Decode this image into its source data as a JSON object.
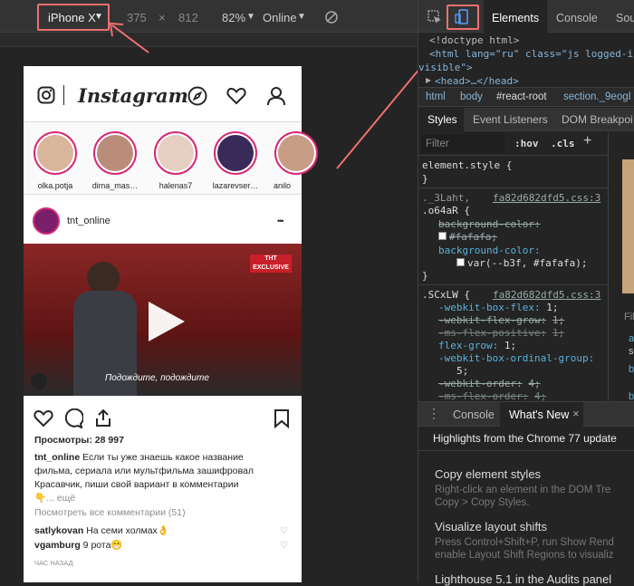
{
  "toolbar": {
    "device": "iPhone X",
    "width": "375",
    "times": "×",
    "height": "812",
    "zoom": "82%",
    "network": "Online"
  },
  "devtools": {
    "tabs": [
      "Elements",
      "Console",
      "Sou"
    ],
    "dom": {
      "line1": "<!doctype html>",
      "line2": "<html lang=\"ru\" class=\"js logged-i",
      "line3": "visible\">",
      "line4": "<head>…</head>"
    },
    "breadcrumb": [
      "html",
      "body",
      "#react-root",
      "section._9eogI"
    ],
    "style_tabs": [
      "Styles",
      "Event Listeners",
      "DOM Breakpoi"
    ],
    "filter_placeholder": "Filter",
    "hov": ":hov",
    "cls": ".cls",
    "plus": "+",
    "rules": {
      "r0_selector": "element.style {",
      "r0_close": "}",
      "r1_selector": "._3Laht,",
      "r1_selector2": ".o64aR {",
      "r1_link": "fa82d682dfd5.css:3",
      "r1_p1": "background-color:",
      "r1_v1": "#fafafa;",
      "r1_p2": "background-color:",
      "r1_v2": "var(--b3f, #fafafa);",
      "r1_close": "}",
      "r2_selector": ".SCxLW {",
      "r2_link": "fa82d682dfd5.css:3",
      "r2_p1": "-webkit-box-flex:",
      "r2_v1": "1;",
      "r2_p2": "-webkit-flex-grow:",
      "r2_v2": "1;",
      "r2_p3": "-ms-flex-positive:",
      "r2_v3": "1;",
      "r2_p4": "flex-grow:",
      "r2_v4": "1;",
      "r2_p5": "-webkit-box-ordinal-group:",
      "r2_v5": "5;",
      "r2_p6": "-webkit-order:",
      "r2_v6": "4;",
      "r2_p7": "-ms-flex-order:",
      "r2_v7": "4;"
    },
    "side_frag": [
      "Filt",
      "a",
      "s",
      "b",
      "b"
    ],
    "drawer_tabs": [
      "Console",
      "What's New"
    ],
    "drawer_close": "×",
    "whats_new_title": "Highlights from the Chrome 77 update",
    "items": [
      {
        "title": "Copy element styles",
        "desc1": "Right-click an element in the DOM Tre",
        "desc2": "Copy > Copy Styles."
      },
      {
        "title": "Visualize layout shifts",
        "desc1": "Press Control+Shift+P, run Show Rend",
        "desc2": "enable Layout Shift Regions to visualiz"
      },
      {
        "title": "Lighthouse 5.1 in the Audits panel",
        "desc1": "",
        "desc2": ""
      }
    ]
  },
  "instagram": {
    "logo": "Instagram",
    "stories": [
      "olka.potja",
      "dima_mas…",
      "halenas7",
      "lazarevser…",
      "anilo"
    ],
    "post_user": "tnt_online",
    "more": "•••",
    "video_badge": "THT EXCLUSIVE",
    "caption_overlay": "Подождите, подождите",
    "views": "Просмотры: 28 997",
    "caption_user": "tnt_online",
    "caption_l1": " Если ты уже знаешь какое название",
    "caption_l2": "фильма, сериала или мультфильма зашифровал",
    "caption_l3": "Красавчик, пиши свой вариант в комментарии",
    "caption_l4": "👇... ещё",
    "view_all": "Посмотреть все комментарии (51)",
    "comments": [
      {
        "user": "satlykovan",
        "text": " На семи холмах👌"
      },
      {
        "user": "vgamburg",
        "text": " 9 рота😁"
      }
    ],
    "time": "ЧАС НАЗАД"
  },
  "colors": {
    "accent": "#f07070",
    "devtools_bg": "#242424",
    "story_ring": "#d62976",
    "css_prop": "#5db0d7"
  }
}
